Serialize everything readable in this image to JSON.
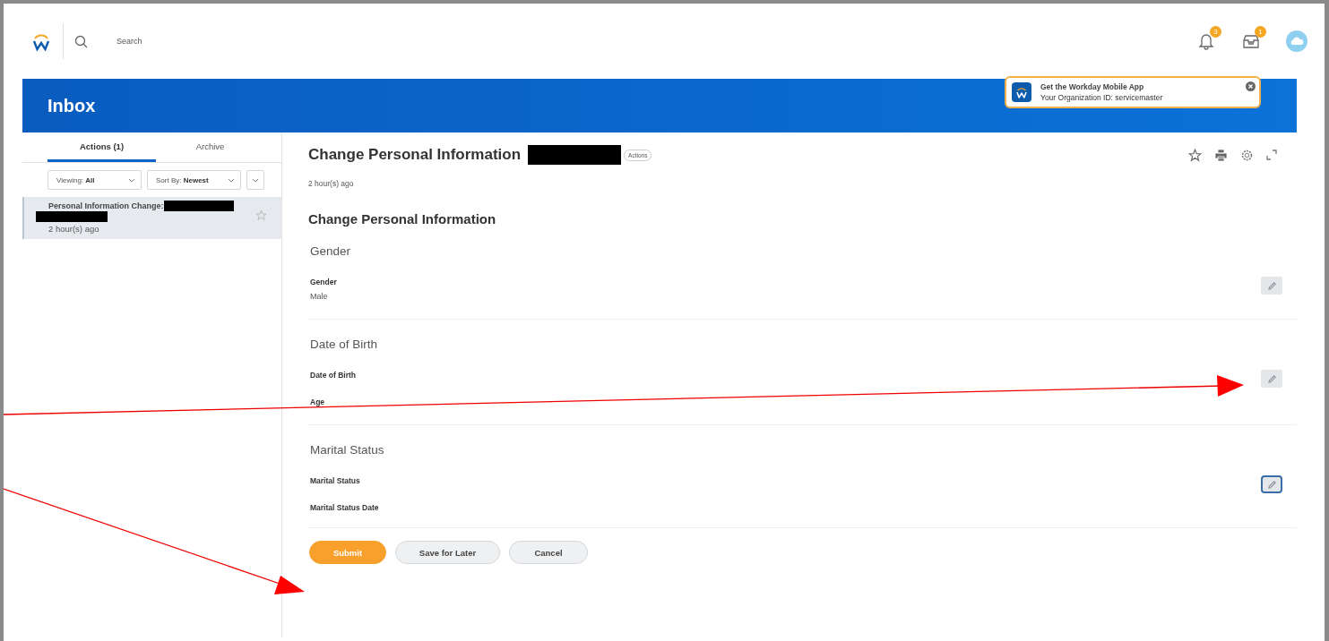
{
  "top_bar": {
    "search": {
      "placeholder": "Search"
    },
    "notifications_badge": "3",
    "inbox_badge": "1"
  },
  "banner": {
    "title": "Inbox"
  },
  "promo": {
    "title": "Get the Workday Mobile App",
    "subtitle": "Your Organization ID: servicemaster"
  },
  "sidebar": {
    "tabs": [
      {
        "label": "Actions (1)",
        "selected": true
      },
      {
        "label": "Archive",
        "selected": false
      }
    ],
    "filters": [
      {
        "prefix": "Viewing:",
        "value": "All"
      },
      {
        "prefix": "Sort By:",
        "value": "Newest"
      }
    ],
    "items": [
      {
        "title": "Personal Information Change:",
        "time": "2 hour(s) ago",
        "selected": true,
        "starred": false
      }
    ]
  },
  "task": {
    "title": "Change Personal Information",
    "actions_label": "Actions",
    "time": "2 hour(s) ago",
    "heading": "Change Personal Information",
    "sections": [
      {
        "title": "Gender",
        "edit_focused": false,
        "fields": [
          {
            "label": "Gender",
            "value": "Male"
          }
        ]
      },
      {
        "title": "Date of Birth",
        "edit_focused": false,
        "fields": [
          {
            "label": "Date of Birth"
          },
          {
            "label": "Age"
          }
        ]
      },
      {
        "title": "Marital Status",
        "edit_focused": true,
        "fields": [
          {
            "label": "Marital Status"
          },
          {
            "label": "Marital Status Date"
          }
        ]
      }
    ],
    "buttons": [
      {
        "label": "Submit",
        "kind": "primary"
      },
      {
        "label": "Save for Later",
        "kind": "secondary"
      },
      {
        "label": "Cancel",
        "kind": "secondary"
      }
    ]
  }
}
